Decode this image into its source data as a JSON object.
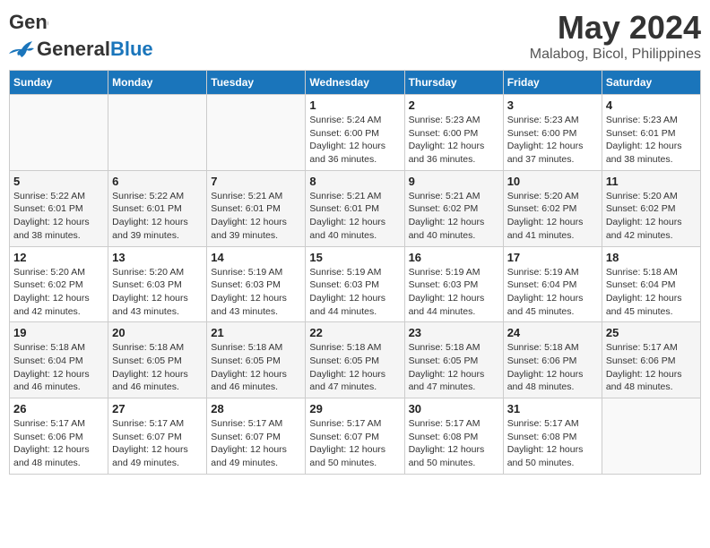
{
  "header": {
    "logo": {
      "general": "General",
      "blue": "Blue"
    },
    "title": "May 2024",
    "location": "Malabog, Bicol, Philippines"
  },
  "days_of_week": [
    "Sunday",
    "Monday",
    "Tuesday",
    "Wednesday",
    "Thursday",
    "Friday",
    "Saturday"
  ],
  "weeks": [
    [
      {
        "day": null
      },
      {
        "day": null
      },
      {
        "day": null
      },
      {
        "day": "1",
        "sunrise": "Sunrise: 5:24 AM",
        "sunset": "Sunset: 6:00 PM",
        "daylight": "Daylight: 12 hours and 36 minutes."
      },
      {
        "day": "2",
        "sunrise": "Sunrise: 5:23 AM",
        "sunset": "Sunset: 6:00 PM",
        "daylight": "Daylight: 12 hours and 36 minutes."
      },
      {
        "day": "3",
        "sunrise": "Sunrise: 5:23 AM",
        "sunset": "Sunset: 6:00 PM",
        "daylight": "Daylight: 12 hours and 37 minutes."
      },
      {
        "day": "4",
        "sunrise": "Sunrise: 5:23 AM",
        "sunset": "Sunset: 6:01 PM",
        "daylight": "Daylight: 12 hours and 38 minutes."
      }
    ],
    [
      {
        "day": "5",
        "sunrise": "Sunrise: 5:22 AM",
        "sunset": "Sunset: 6:01 PM",
        "daylight": "Daylight: 12 hours and 38 minutes."
      },
      {
        "day": "6",
        "sunrise": "Sunrise: 5:22 AM",
        "sunset": "Sunset: 6:01 PM",
        "daylight": "Daylight: 12 hours and 39 minutes."
      },
      {
        "day": "7",
        "sunrise": "Sunrise: 5:21 AM",
        "sunset": "Sunset: 6:01 PM",
        "daylight": "Daylight: 12 hours and 39 minutes."
      },
      {
        "day": "8",
        "sunrise": "Sunrise: 5:21 AM",
        "sunset": "Sunset: 6:01 PM",
        "daylight": "Daylight: 12 hours and 40 minutes."
      },
      {
        "day": "9",
        "sunrise": "Sunrise: 5:21 AM",
        "sunset": "Sunset: 6:02 PM",
        "daylight": "Daylight: 12 hours and 40 minutes."
      },
      {
        "day": "10",
        "sunrise": "Sunrise: 5:20 AM",
        "sunset": "Sunset: 6:02 PM",
        "daylight": "Daylight: 12 hours and 41 minutes."
      },
      {
        "day": "11",
        "sunrise": "Sunrise: 5:20 AM",
        "sunset": "Sunset: 6:02 PM",
        "daylight": "Daylight: 12 hours and 42 minutes."
      }
    ],
    [
      {
        "day": "12",
        "sunrise": "Sunrise: 5:20 AM",
        "sunset": "Sunset: 6:02 PM",
        "daylight": "Daylight: 12 hours and 42 minutes."
      },
      {
        "day": "13",
        "sunrise": "Sunrise: 5:20 AM",
        "sunset": "Sunset: 6:03 PM",
        "daylight": "Daylight: 12 hours and 43 minutes."
      },
      {
        "day": "14",
        "sunrise": "Sunrise: 5:19 AM",
        "sunset": "Sunset: 6:03 PM",
        "daylight": "Daylight: 12 hours and 43 minutes."
      },
      {
        "day": "15",
        "sunrise": "Sunrise: 5:19 AM",
        "sunset": "Sunset: 6:03 PM",
        "daylight": "Daylight: 12 hours and 44 minutes."
      },
      {
        "day": "16",
        "sunrise": "Sunrise: 5:19 AM",
        "sunset": "Sunset: 6:03 PM",
        "daylight": "Daylight: 12 hours and 44 minutes."
      },
      {
        "day": "17",
        "sunrise": "Sunrise: 5:19 AM",
        "sunset": "Sunset: 6:04 PM",
        "daylight": "Daylight: 12 hours and 45 minutes."
      },
      {
        "day": "18",
        "sunrise": "Sunrise: 5:18 AM",
        "sunset": "Sunset: 6:04 PM",
        "daylight": "Daylight: 12 hours and 45 minutes."
      }
    ],
    [
      {
        "day": "19",
        "sunrise": "Sunrise: 5:18 AM",
        "sunset": "Sunset: 6:04 PM",
        "daylight": "Daylight: 12 hours and 46 minutes."
      },
      {
        "day": "20",
        "sunrise": "Sunrise: 5:18 AM",
        "sunset": "Sunset: 6:05 PM",
        "daylight": "Daylight: 12 hours and 46 minutes."
      },
      {
        "day": "21",
        "sunrise": "Sunrise: 5:18 AM",
        "sunset": "Sunset: 6:05 PM",
        "daylight": "Daylight: 12 hours and 46 minutes."
      },
      {
        "day": "22",
        "sunrise": "Sunrise: 5:18 AM",
        "sunset": "Sunset: 6:05 PM",
        "daylight": "Daylight: 12 hours and 47 minutes."
      },
      {
        "day": "23",
        "sunrise": "Sunrise: 5:18 AM",
        "sunset": "Sunset: 6:05 PM",
        "daylight": "Daylight: 12 hours and 47 minutes."
      },
      {
        "day": "24",
        "sunrise": "Sunrise: 5:18 AM",
        "sunset": "Sunset: 6:06 PM",
        "daylight": "Daylight: 12 hours and 48 minutes."
      },
      {
        "day": "25",
        "sunrise": "Sunrise: 5:17 AM",
        "sunset": "Sunset: 6:06 PM",
        "daylight": "Daylight: 12 hours and 48 minutes."
      }
    ],
    [
      {
        "day": "26",
        "sunrise": "Sunrise: 5:17 AM",
        "sunset": "Sunset: 6:06 PM",
        "daylight": "Daylight: 12 hours and 48 minutes."
      },
      {
        "day": "27",
        "sunrise": "Sunrise: 5:17 AM",
        "sunset": "Sunset: 6:07 PM",
        "daylight": "Daylight: 12 hours and 49 minutes."
      },
      {
        "day": "28",
        "sunrise": "Sunrise: 5:17 AM",
        "sunset": "Sunset: 6:07 PM",
        "daylight": "Daylight: 12 hours and 49 minutes."
      },
      {
        "day": "29",
        "sunrise": "Sunrise: 5:17 AM",
        "sunset": "Sunset: 6:07 PM",
        "daylight": "Daylight: 12 hours and 50 minutes."
      },
      {
        "day": "30",
        "sunrise": "Sunrise: 5:17 AM",
        "sunset": "Sunset: 6:08 PM",
        "daylight": "Daylight: 12 hours and 50 minutes."
      },
      {
        "day": "31",
        "sunrise": "Sunrise: 5:17 AM",
        "sunset": "Sunset: 6:08 PM",
        "daylight": "Daylight: 12 hours and 50 minutes."
      },
      {
        "day": null
      }
    ]
  ]
}
